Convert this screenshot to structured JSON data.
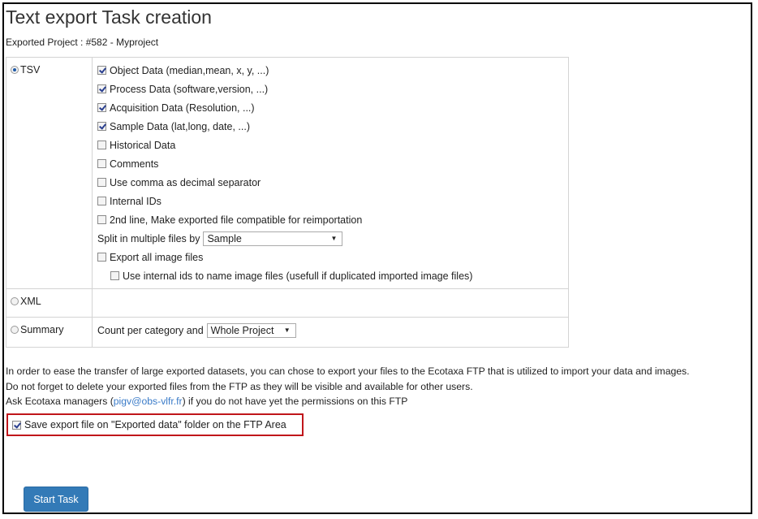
{
  "header": {
    "title": "Text export Task creation",
    "subtitle": "Exported Project : #582 - Myproject"
  },
  "formats": {
    "tsv": {
      "label": "TSV",
      "selected": true,
      "options": [
        {
          "label": "Object Data (median,mean, x, y, ...)",
          "checked": true
        },
        {
          "label": "Process Data (software,version, ...)",
          "checked": true
        },
        {
          "label": "Acquisition Data (Resolution, ...)",
          "checked": true
        },
        {
          "label": "Sample Data (lat,long, date, ...)",
          "checked": true
        },
        {
          "label": "Historical Data",
          "checked": false
        },
        {
          "label": "Comments",
          "checked": false
        },
        {
          "label": "Use comma as decimal separator",
          "checked": false
        },
        {
          "label": "Internal IDs",
          "checked": false
        },
        {
          "label": "2nd line, Make exported file compatible for reimportation",
          "checked": false
        }
      ],
      "split_label": "Split in multiple files by",
      "split_value": "Sample",
      "export_images": {
        "label": "Export all image files",
        "checked": false
      },
      "internal_ids_names": {
        "label": "Use internal ids to name image files (usefull if duplicated imported image files)",
        "checked": false
      }
    },
    "xml": {
      "label": "XML",
      "selected": false
    },
    "summary": {
      "label": "Summary",
      "selected": false,
      "count_label": "Count per category and",
      "count_value": "Whole Project"
    }
  },
  "ftp": {
    "line1": "In order to ease the transfer of large exported datasets, you can chose to export your files to the Ecotaxa FTP that is utilized to import your data and images.",
    "line2": "Do not forget to delete your exported files from the FTP as they will be visible and available for other users.",
    "line3_prefix": "Ask Ecotaxa managers (",
    "line3_email": "pigv@obs-vlfr.fr",
    "line3_suffix": ") if you do not have yet the permissions on this FTP",
    "save_label": "Save export file on \"Exported data\" folder on the FTP Area",
    "save_checked": true
  },
  "actions": {
    "start_label": "Start Task"
  },
  "colors": {
    "accent": "#337ab7",
    "highlight": "#c0161b",
    "link": "#3a7bc8"
  }
}
